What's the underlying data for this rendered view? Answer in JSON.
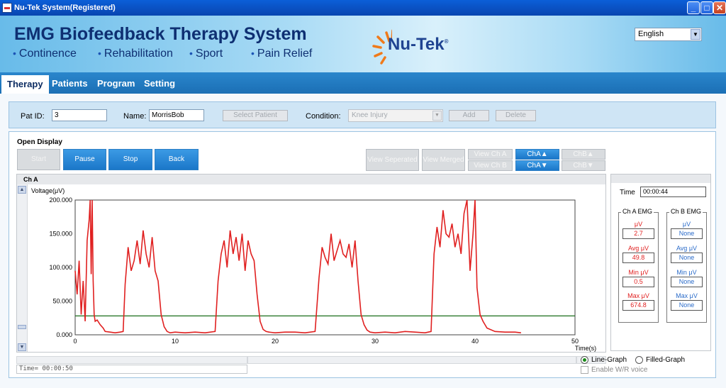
{
  "window": {
    "title": "Nu-Tek System(Registered)"
  },
  "banner": {
    "title": "EMG Biofeedback Therapy System",
    "features": [
      "Continence",
      "Rehabilitation",
      "Sport",
      "Pain Relief"
    ],
    "logo_text": "Nu-Tek",
    "logo_mark": "®",
    "language": "English"
  },
  "tabs": [
    "Therapy",
    "Patients",
    "Program",
    "Setting"
  ],
  "patient": {
    "pat_id_label": "Pat ID:",
    "pat_id": "3",
    "name_label": "Name:",
    "name": "MorrisBob",
    "select_patient": "Select Patient",
    "condition_label": "Condition:",
    "condition": "Knee Injury",
    "add": "Add",
    "delete": "Delete"
  },
  "display": {
    "title": "Open Display",
    "start": "Start",
    "pause": "Pause",
    "stop": "Stop",
    "back": "Back",
    "view_separated": "View Seperated",
    "view_merged": "View Merged",
    "view_ch_a": "View Ch A",
    "view_ch_b": "View Ch B",
    "cha_up": "ChA▲",
    "cha_down": "ChA▼",
    "chb_up": "ChB▲",
    "chb_down": "ChB▼",
    "channel": "Ch A",
    "time_readout": "Time= 00:00:50"
  },
  "side": {
    "time_label": "Time",
    "time": "00:00:44",
    "cha_title": "Ch A EMG",
    "chb_title": "Ch B EMG",
    "labels": [
      "μV",
      "Avg μV",
      "Min μV",
      "Max μV"
    ],
    "cha_values": [
      "2.7",
      "49.8",
      "0.5",
      "674.8"
    ],
    "chb_values": [
      "None",
      "None",
      "None",
      "None"
    ]
  },
  "options": {
    "line_graph": "Line-Graph",
    "filled_graph": "Filled-Graph",
    "voice": "Enable W/R voice",
    "graph_mode": "line"
  },
  "colors": {
    "signal": "#e02020",
    "threshold": "#1a6e1a",
    "accent": "#1b77c9"
  },
  "chart_data": {
    "type": "line",
    "ylabel": "Voltage(μV)",
    "xlabel": "Time(s)",
    "xlim": [
      0,
      50
    ],
    "ylim": [
      0,
      200
    ],
    "xticks": [
      "0",
      "10",
      "20",
      "30",
      "40",
      "50"
    ],
    "yticks": [
      "0.000",
      "50.000",
      "100.000",
      "150.000",
      "200.000"
    ],
    "threshold": 28,
    "series": [
      {
        "x": [
          0,
          0.2,
          0.4,
          0.6,
          0.8,
          1.0,
          1.2,
          1.4,
          1.5,
          1.6,
          1.7,
          1.8,
          1.9,
          2.0,
          2.2,
          2.5,
          2.8,
          3.0,
          3.5,
          4.0,
          4.5,
          4.8,
          5.0,
          5.3,
          5.6,
          5.9,
          6.2,
          6.5,
          6.8,
          7.1,
          7.4,
          7.7,
          8.0,
          8.3,
          8.6,
          8.9,
          9.2,
          9.5,
          10,
          11,
          12,
          13,
          14,
          14.3,
          14.6,
          14.9,
          15.2,
          15.5,
          15.8,
          16.1,
          16.4,
          16.7,
          17.0,
          17.3,
          17.6,
          17.9,
          18.2,
          18.5,
          18.8,
          19.1,
          19.4,
          20,
          21,
          22,
          23,
          24,
          24.4,
          24.7,
          25.0,
          25.3,
          25.6,
          25.9,
          26.2,
          26.5,
          26.8,
          27.1,
          27.4,
          27.7,
          28.0,
          28.3,
          28.6,
          28.9,
          29.2,
          29.5,
          30,
          31,
          32,
          33,
          34,
          35,
          35.6,
          35.9,
          36.2,
          36.5,
          36.8,
          37.1,
          37.4,
          37.7,
          38.0,
          38.3,
          38.6,
          38.9,
          39.2,
          39.5,
          39.8,
          40.0,
          40.2,
          40.5,
          40.8,
          41.2,
          42,
          43,
          44,
          44.6
        ],
        "y": [
          95,
          60,
          110,
          30,
          80,
          20,
          140,
          170,
          210,
          90,
          200,
          80,
          30,
          20,
          22,
          15,
          10,
          5,
          4,
          3,
          4,
          5,
          75,
          130,
          95,
          110,
          140,
          105,
          155,
          120,
          100,
          145,
          95,
          80,
          30,
          12,
          5,
          3,
          4,
          3,
          4,
          3,
          5,
          80,
          120,
          140,
          100,
          155,
          120,
          145,
          110,
          150,
          95,
          140,
          120,
          110,
          60,
          20,
          8,
          5,
          4,
          3,
          4,
          4,
          3,
          5,
          85,
          130,
          115,
          105,
          150,
          110,
          125,
          140,
          120,
          115,
          135,
          100,
          140,
          80,
          30,
          15,
          7,
          4,
          3,
          4,
          3,
          5,
          4,
          3,
          5,
          120,
          160,
          130,
          185,
          150,
          145,
          165,
          130,
          150,
          120,
          180,
          210,
          95,
          150,
          200,
          70,
          30,
          20,
          10,
          5,
          4,
          4,
          3
        ],
        "color": "#e02020"
      }
    ]
  }
}
